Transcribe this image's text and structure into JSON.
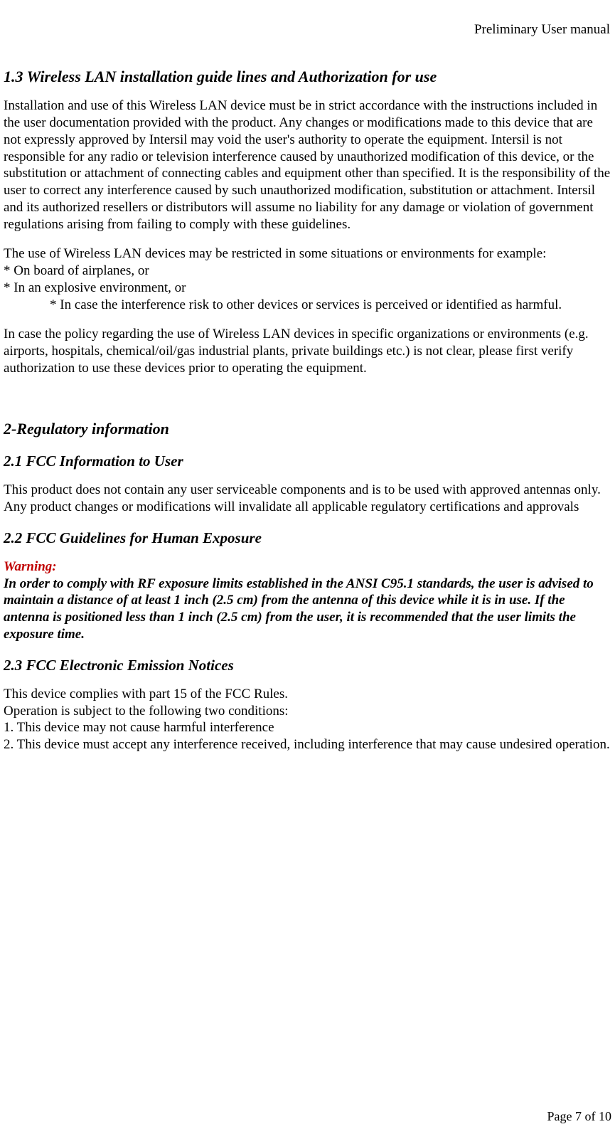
{
  "header": {
    "title": "Preliminary User manual"
  },
  "footer": {
    "page": "Page 7 of 10"
  },
  "s13": {
    "heading": "1.3 Wireless LAN installation guide lines and Authorization for use",
    "p1": "Installation and use of this Wireless LAN device must be in strict accordance with the instructions included in the user documentation provided with the product. Any changes or modifications made to this device that are not expressly approved by Intersil may void the user's authority to operate the equipment. Intersil is not responsible for any radio or television interference caused by unauthorized modification of this device, or the substitution or attachment of connecting cables and equipment other than specified. It is the responsibility of the user to correct any interference caused by such unauthorized modification, substitution or attachment. Intersil and its authorized resellers or distributors will assume no liability for any damage or violation of government regulations arising from failing to comply with these guidelines.",
    "p2": "The use of Wireless LAN devices may be restricted in some situations or environments for example:",
    "li1": "* On board of airplanes, or",
    "li2": "* In an explosive environment, or",
    "li3": "* In case the interference risk to other devices or services is perceived or identified as harmful.",
    "p3": "In case the policy regarding the use of Wireless LAN devices in specific organizations or environments (e.g. airports, hospitals, chemical/oil/gas industrial plants, private buildings etc.) is not clear, please first verify authorization to use these devices prior to operating the equipment."
  },
  "s2": {
    "heading": "2-Regulatory information"
  },
  "s21": {
    "heading": "2.1 FCC Information to User",
    "p1": "This product does not contain any user serviceable components and is to be used with approved antennas only. Any product changes or modifications will invalidate all applicable regulatory certifications and approvals"
  },
  "s22": {
    "heading": "2.2 FCC Guidelines for Human Exposure",
    "warning_label": "Warning:",
    "warning_body": "In order to comply with RF exposure limits established in the ANSI C95.1 standards, the user is advised to maintain a distance of at least 1 inch (2.5 cm) from the antenna of this device while it is in use. If the antenna is positioned less than 1 inch (2.5 cm) from the user, it is recommended that the user limits the exposure time."
  },
  "s23": {
    "heading": "2.3 FCC Electronic Emission Notices",
    "l1": "This device complies with part 15 of the FCC Rules.",
    "l2": "Operation is subject to the following two conditions:",
    "l3": "1. This device may not cause harmful interference",
    "l4": "2. This device must accept any interference received, including interference that may cause undesired operation."
  }
}
